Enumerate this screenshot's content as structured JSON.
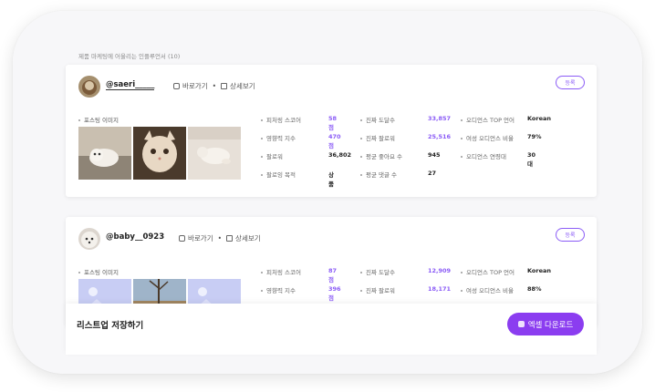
{
  "caption": "제품 마케팅에 어울리는 인플루언서 (10)",
  "links": {
    "go": "바로가기",
    "detail": "상세보기",
    "sep": "•"
  },
  "cards": [
    {
      "handle": "@saeri_____",
      "status": "등록",
      "post_label": "포스팅 이미지",
      "stats": {
        "col1": [
          {
            "k": "피처링 스코어",
            "v": "58점"
          },
          {
            "k": "영향력 지수",
            "v": "470점"
          },
          {
            "k": "팔로워",
            "v": "36,802"
          },
          {
            "k": "팔로잉 목적",
            "v": "상품"
          }
        ],
        "col2": [
          {
            "k": "진짜 도달수",
            "v": "33,857"
          },
          {
            "k": "진짜 팔로워",
            "v": "25,516"
          },
          {
            "k": "평균 좋아요 수",
            "v": "945"
          },
          {
            "k": "평균 댓글 수",
            "v": "27"
          }
        ],
        "col3": [
          {
            "k": "오디언스 TOP 언어",
            "v": "Korean"
          },
          {
            "k": "여성 오디언스 비율",
            "v": "79%"
          },
          {
            "k": "오디언스 연령대",
            "v": "30대"
          }
        ]
      }
    },
    {
      "handle": "@baby__0923",
      "status": "등록",
      "post_label": "포스팅 이미지",
      "stats": {
        "col1": [
          {
            "k": "피처링 스코어",
            "v": "87점"
          },
          {
            "k": "영향력 지수",
            "v": "396점"
          }
        ],
        "col2": [
          {
            "k": "진짜 도달수",
            "v": "12,909"
          },
          {
            "k": "진짜 팔로워",
            "v": "18,171"
          }
        ],
        "col3": [
          {
            "k": "오디언스 TOP 언어",
            "v": "Korean"
          },
          {
            "k": "여성 오디언스 비율",
            "v": "88%"
          }
        ]
      }
    }
  ],
  "footer": {
    "title": "리스트업 저장하기",
    "excel_button": "엑셀 다운로드"
  },
  "colors": {
    "accent": "#8b3df0",
    "purple_text": "#8b5cf6"
  },
  "icons": [
    "instagram-icon",
    "calendar-icon",
    "excel-icon"
  ]
}
